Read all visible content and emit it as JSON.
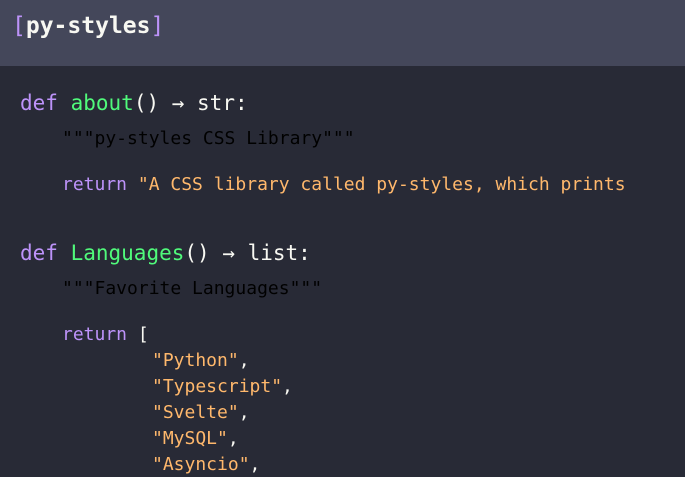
{
  "header": {
    "open_bracket": "[",
    "title": "py-styles",
    "close_bracket": "]"
  },
  "code": {
    "about_def": {
      "keyword": "def",
      "name": "about",
      "signature": "() → str:"
    },
    "about_docstring": "\"\"\"py-styles CSS Library\"\"\"",
    "about_return": {
      "keyword": "return",
      "value": "\"A CSS library called py-styles, which prints"
    },
    "languages_def": {
      "keyword": "def",
      "name": "Languages",
      "signature": "() → list:"
    },
    "languages_docstring": "\"\"\"Favorite Languages\"\"\"",
    "languages_return": {
      "keyword": "return",
      "open": "["
    },
    "languages": [
      "\"Python\"",
      "\"Typescript\"",
      "\"Svelte\"",
      "\"MySQL\"",
      "\"Asyncio\""
    ],
    "separator": ","
  },
  "colors": {
    "background": "#282a36",
    "header_background": "#44475a",
    "keyword": "#bd93f9",
    "function": "#50fa7b",
    "text": "#f8f8f2",
    "docstring": "#6272a4",
    "string": "#ffb86c"
  }
}
